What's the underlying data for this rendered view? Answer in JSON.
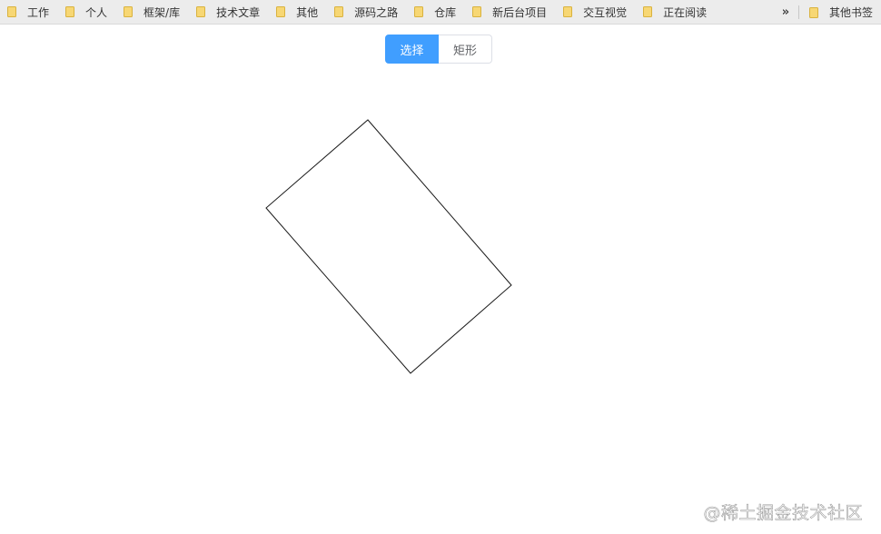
{
  "bookmarks": {
    "items": [
      {
        "label": "工作"
      },
      {
        "label": "个人"
      },
      {
        "label": "框架/库"
      },
      {
        "label": "技术文章"
      },
      {
        "label": "其他"
      },
      {
        "label": "源码之路"
      },
      {
        "label": "仓库"
      },
      {
        "label": "新后台项目"
      },
      {
        "label": "交互视觉"
      },
      {
        "label": "正在阅读"
      }
    ],
    "overflow_icon": "double-chevron-right-icon",
    "other_label": "其他书签",
    "folder_color": "#f7d774"
  },
  "toolbar": {
    "select_label": "选择",
    "rect_label": "矩形",
    "active_mode": "选择",
    "accent_color": "#409eff"
  },
  "watermark": {
    "text": "@稀土掘金技术社区"
  }
}
